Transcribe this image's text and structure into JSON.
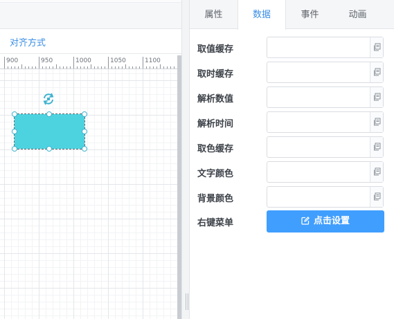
{
  "toolbar": {
    "align_label": "对齐方式"
  },
  "ruler": {
    "ticks": [
      "900",
      "950",
      "1000",
      "1050",
      "1100"
    ]
  },
  "tabs": [
    {
      "label": "属性",
      "active": false
    },
    {
      "label": "数据",
      "active": true
    },
    {
      "label": "事件",
      "active": false
    },
    {
      "label": "动画",
      "active": false
    }
  ],
  "fields": [
    {
      "label": "取值缓存",
      "value": ""
    },
    {
      "label": "取时缓存",
      "value": ""
    },
    {
      "label": "解析数值",
      "value": ""
    },
    {
      "label": "解析时间",
      "value": ""
    },
    {
      "label": "取色缓存",
      "value": ""
    },
    {
      "label": "文字颜色",
      "value": ""
    },
    {
      "label": "背景颜色",
      "value": ""
    }
  ],
  "context_menu": {
    "label": "右键菜单",
    "button_label": "点击设置",
    "button_icon": "edit-icon"
  },
  "colors": {
    "accent": "#409eff",
    "shape_fill": "#4dd3e0",
    "active_tab": "#3a8ee6"
  }
}
